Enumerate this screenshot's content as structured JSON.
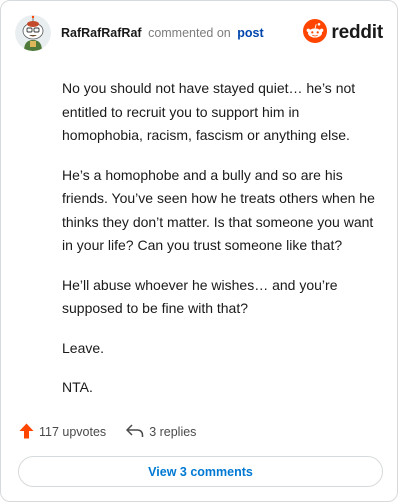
{
  "header": {
    "username": "RafRafRafRaf",
    "action_text": "commented on",
    "target_link": "post",
    "brand_wordmark": "reddit",
    "avatar_icon": "snoo-avatar-icon",
    "brand_icon": "reddit-snoo-icon"
  },
  "comment": {
    "paragraphs": [
      "No you should not have stayed quiet… he’s not entitled to recruit you to support him in homophobia, racism, fascism or anything else.",
      "He’s a homophobe and a bully and so are his friends. You’ve seen how he treats others when he thinks they don’t matter. Is that someone you want in your life? Can you trust someone like that?",
      "He’ll abuse whoever he wishes… and you’re supposed to be fine with that?",
      "Leave.",
      "NTA."
    ]
  },
  "stats": {
    "upvotes": "117 upvotes",
    "replies": "3 replies",
    "upvote_icon": "upvote-arrow-icon",
    "reply_icon": "reply-arrow-icon"
  },
  "footer": {
    "view_comments_label": "View 3 comments"
  },
  "colors": {
    "reddit_orange": "#ff4500",
    "link_blue": "#0045ac",
    "button_blue": "#0079d3",
    "border": "#d7dadc"
  }
}
